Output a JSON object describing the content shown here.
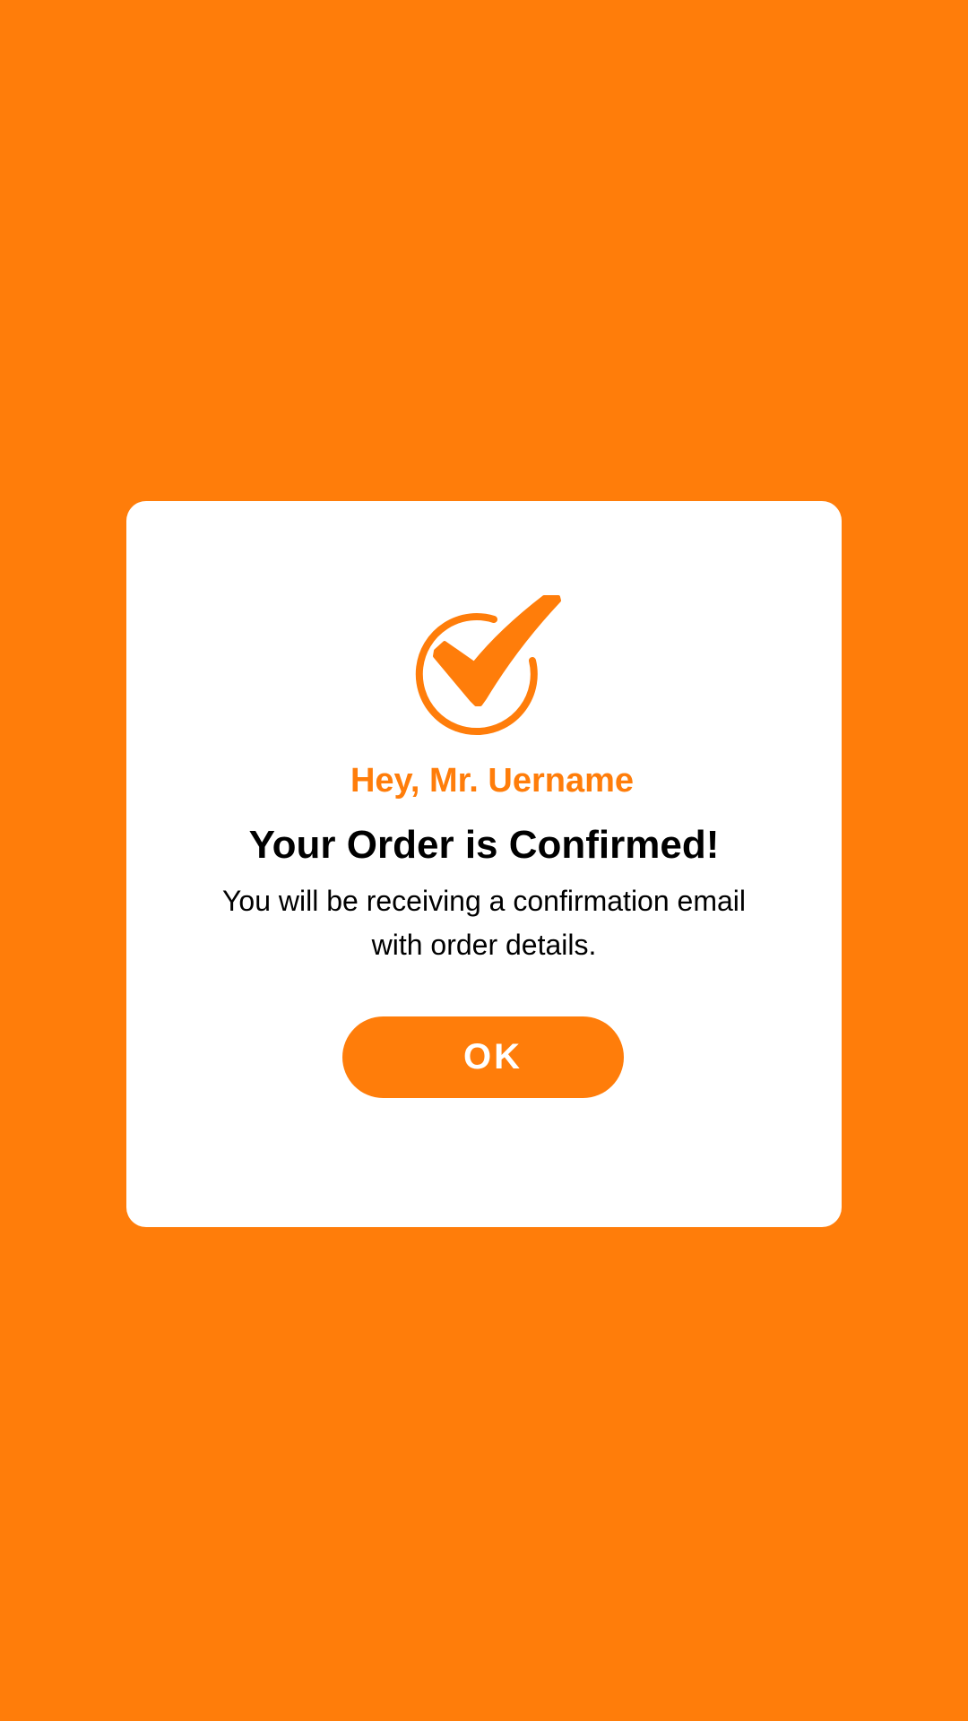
{
  "colors": {
    "background": "#FF7D0A",
    "accent": "#FF7D0A",
    "dialog": "#FFFFFF",
    "text": "#000000",
    "button_text": "#FFFFFF"
  },
  "dialog": {
    "icon": "check-circle-icon",
    "greeting": "Hey, Mr. Uername",
    "title": "Your Order is Confirmed!",
    "message": "You will be receiving a confirmation email with order details.",
    "ok_label": "OK"
  }
}
